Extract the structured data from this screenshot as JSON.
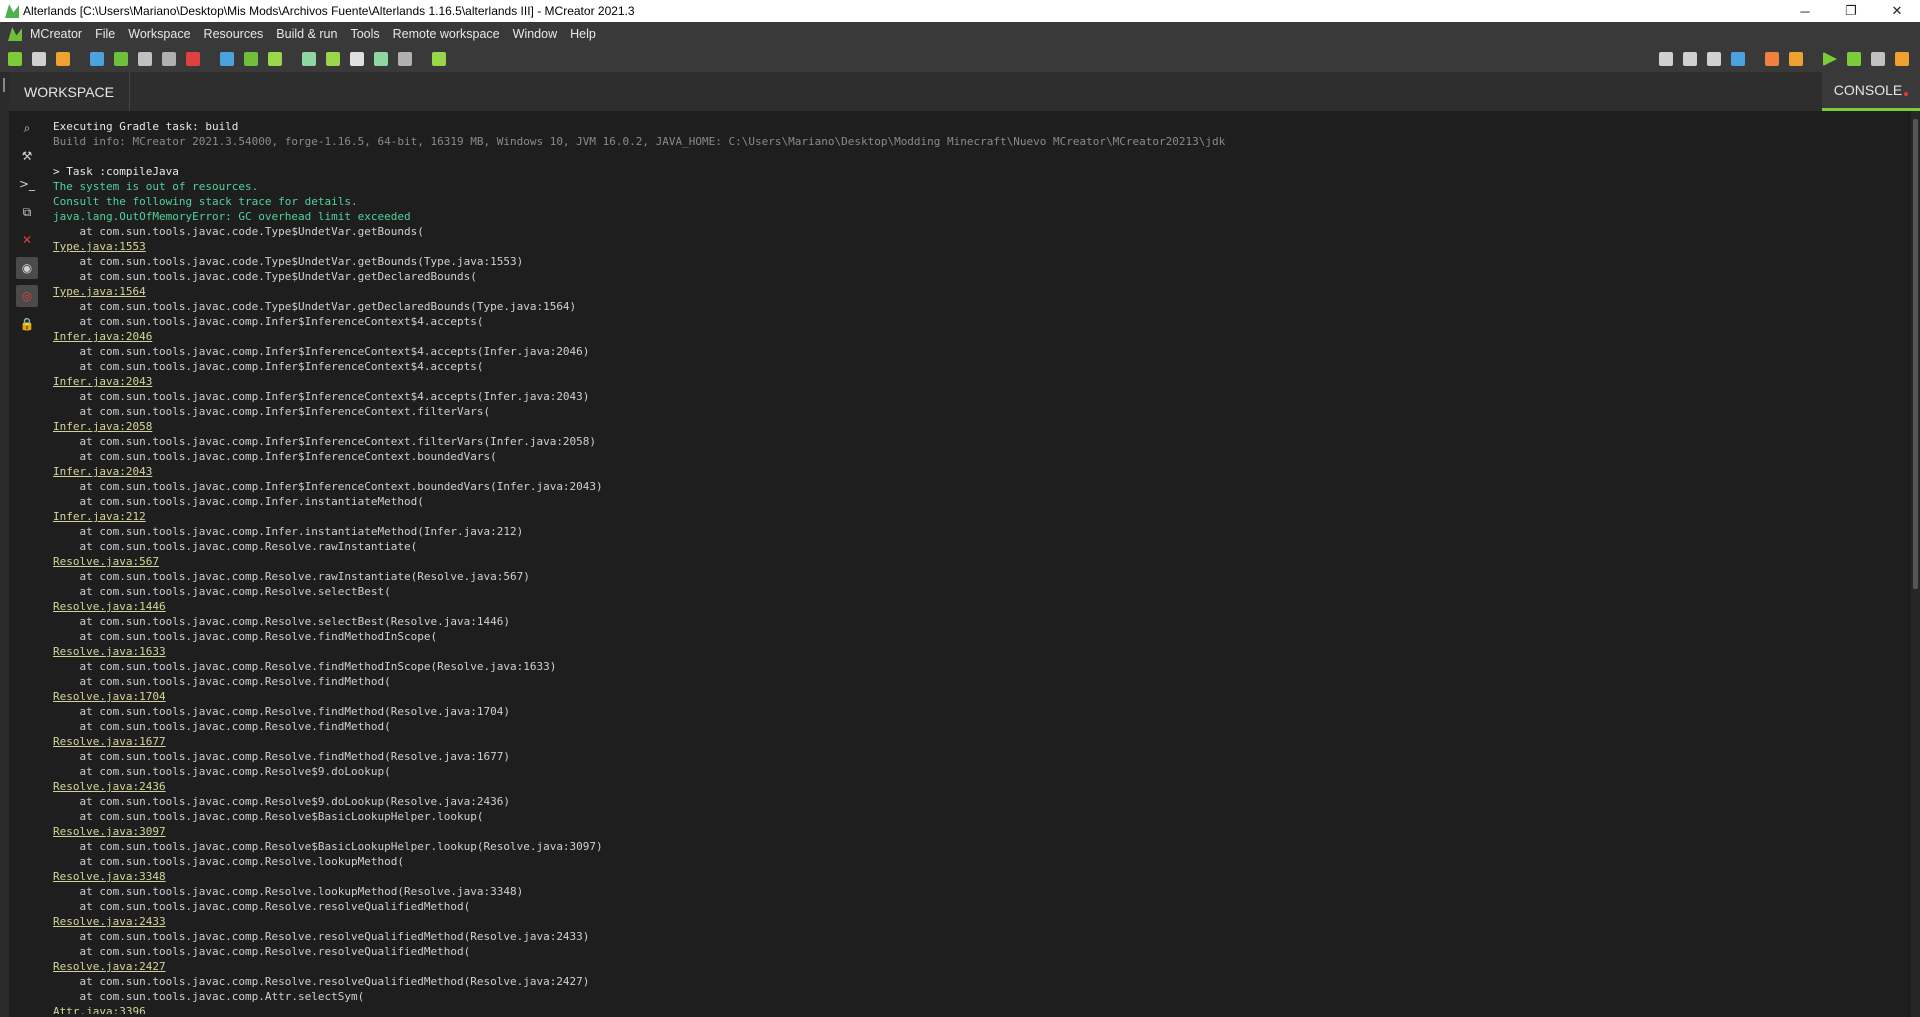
{
  "window": {
    "title": "Alterlands [C:\\Users\\Mariano\\Desktop\\Mis Mods\\Archivos Fuente\\Alterlands 1.16.5\\alterlands III] - MCreator 2021.3",
    "controls": {
      "minimize": "─",
      "restore": "❐",
      "close": "✕"
    }
  },
  "menu": {
    "items": [
      "MCreator",
      "File",
      "Workspace",
      "Resources",
      "Build & run",
      "Tools",
      "Remote workspace",
      "Window",
      "Help"
    ]
  },
  "toolbar": {
    "left_icons": [
      {
        "name": "new-element-icon",
        "color": "#7ccc3a"
      },
      {
        "name": "workspace-icon",
        "color": "#cfcfcf"
      },
      {
        "name": "import-icon",
        "color": "#f0a030"
      },
      {
        "name": "resources-icon",
        "color": "#4aa3df"
      },
      {
        "name": "image-icon",
        "color": "#6fbf3b"
      },
      {
        "name": "structure-icon",
        "color": "#c0c0c0"
      },
      {
        "name": "sound-icon",
        "color": "#b0b0b0"
      },
      {
        "name": "texture-icon",
        "color": "#e04040"
      },
      {
        "name": "armor-icon",
        "color": "#4aa3df"
      },
      {
        "name": "recipe-icon",
        "color": "#6fbf3b"
      },
      {
        "name": "animation-icon",
        "color": "#9ad64a"
      },
      {
        "name": "plugin-icon",
        "color": "#8fd6a0"
      },
      {
        "name": "tools-icon",
        "color": "#9ad64a"
      },
      {
        "name": "gear-icon",
        "color": "#e0e0e0"
      },
      {
        "name": "mod-icon",
        "color": "#8fd6a0"
      },
      {
        "name": "block-icon",
        "color": "#b0b0b0"
      },
      {
        "name": "pencil-icon",
        "color": "#9ad64a"
      }
    ],
    "right_icons": [
      {
        "name": "branch-icon",
        "color": "#d0d0d0"
      },
      {
        "name": "pull-icon",
        "color": "#d0d0d0"
      },
      {
        "name": "push-icon",
        "color": "#d0d0d0"
      },
      {
        "name": "folder-icon",
        "color": "#4aa3df"
      },
      {
        "name": "eraser-icon",
        "color": "#f08040"
      },
      {
        "name": "hammer-icon",
        "color": "#f0a030"
      },
      {
        "name": "play-icon",
        "color": "#7ccc3a"
      },
      {
        "name": "debug-icon",
        "color": "#7ccc3a"
      },
      {
        "name": "stop-icon",
        "color": "#c0c0c0"
      },
      {
        "name": "export-icon",
        "color": "#f0a030"
      }
    ]
  },
  "tabs": {
    "workspace": "WORKSPACE",
    "console": "CONSOLE"
  },
  "sidebar": {
    "buttons": [
      {
        "name": "search-icon",
        "glyph": "⌕",
        "active": false
      },
      {
        "name": "hammer-icon",
        "glyph": "⚒",
        "active": false
      },
      {
        "name": "terminal-icon",
        "glyph": ">_",
        "active": false
      },
      {
        "name": "copy-icon",
        "glyph": "⧉",
        "active": false
      },
      {
        "name": "close-icon",
        "glyph": "✕",
        "active": false,
        "color": "#e04040"
      },
      {
        "name": "eye-icon",
        "glyph": "◉",
        "active": true
      },
      {
        "name": "eye-off-icon",
        "glyph": "◎",
        "active": true,
        "color": "#e04040"
      },
      {
        "name": "lock-icon",
        "glyph": "🔒",
        "active": false
      }
    ]
  },
  "console": {
    "lines": [
      {
        "t": "Executing Gradle task: build",
        "s": "normal"
      },
      {
        "t": "Build info: MCreator 2021.3.54000, forge-1.16.5, 64-bit, 16319 MB, Windows 10, JVM 16.0.2, JAVA_HOME: C:\\Users\\Mariano\\Desktop\\Modding Minecraft\\Nuevo MCreator\\MCreator20213\\jdk",
        "s": "dim"
      },
      {
        "t": "",
        "s": "normal"
      },
      {
        "t": "> Task :compileJava",
        "s": "normal"
      },
      {
        "t": "The system is out of resources.",
        "s": "green"
      },
      {
        "t": "Consult the following stack trace for details.",
        "s": "green"
      },
      {
        "t": "java.lang.OutOfMemoryError: GC overhead limit exceeded",
        "s": "green"
      },
      {
        "t": "    at com.sun.tools.javac.code.Type$UndetVar.getBounds(",
        "s": "at"
      },
      {
        "t": "Type.java:1553",
        "s": "link"
      },
      {
        "t": "    at com.sun.tools.javac.code.Type$UndetVar.getBounds(Type.java:1553)",
        "s": "at"
      },
      {
        "t": "    at com.sun.tools.javac.code.Type$UndetVar.getDeclaredBounds(",
        "s": "at"
      },
      {
        "t": "Type.java:1564",
        "s": "link"
      },
      {
        "t": "    at com.sun.tools.javac.code.Type$UndetVar.getDeclaredBounds(Type.java:1564)",
        "s": "at"
      },
      {
        "t": "    at com.sun.tools.javac.comp.Infer$InferenceContext$4.accepts(",
        "s": "at"
      },
      {
        "t": "Infer.java:2046",
        "s": "link"
      },
      {
        "t": "    at com.sun.tools.javac.comp.Infer$InferenceContext$4.accepts(Infer.java:2046)",
        "s": "at"
      },
      {
        "t": "    at com.sun.tools.javac.comp.Infer$InferenceContext$4.accepts(",
        "s": "at"
      },
      {
        "t": "Infer.java:2043",
        "s": "link"
      },
      {
        "t": "    at com.sun.tools.javac.comp.Infer$InferenceContext$4.accepts(Infer.java:2043)",
        "s": "at"
      },
      {
        "t": "    at com.sun.tools.javac.comp.Infer$InferenceContext.filterVars(",
        "s": "at"
      },
      {
        "t": "Infer.java:2058",
        "s": "link"
      },
      {
        "t": "    at com.sun.tools.javac.comp.Infer$InferenceContext.filterVars(Infer.java:2058)",
        "s": "at"
      },
      {
        "t": "    at com.sun.tools.javac.comp.Infer$InferenceContext.boundedVars(",
        "s": "at"
      },
      {
        "t": "Infer.java:2043",
        "s": "link"
      },
      {
        "t": "    at com.sun.tools.javac.comp.Infer$InferenceContext.boundedVars(Infer.java:2043)",
        "s": "at"
      },
      {
        "t": "    at com.sun.tools.javac.comp.Infer.instantiateMethod(",
        "s": "at"
      },
      {
        "t": "Infer.java:212",
        "s": "link"
      },
      {
        "t": "    at com.sun.tools.javac.comp.Infer.instantiateMethod(Infer.java:212)",
        "s": "at"
      },
      {
        "t": "    at com.sun.tools.javac.comp.Resolve.rawInstantiate(",
        "s": "at"
      },
      {
        "t": "Resolve.java:567",
        "s": "link"
      },
      {
        "t": "    at com.sun.tools.javac.comp.Resolve.rawInstantiate(Resolve.java:567)",
        "s": "at"
      },
      {
        "t": "    at com.sun.tools.javac.comp.Resolve.selectBest(",
        "s": "at"
      },
      {
        "t": "Resolve.java:1446",
        "s": "link"
      },
      {
        "t": "    at com.sun.tools.javac.comp.Resolve.selectBest(Resolve.java:1446)",
        "s": "at"
      },
      {
        "t": "    at com.sun.tools.javac.comp.Resolve.findMethodInScope(",
        "s": "at"
      },
      {
        "t": "Resolve.java:1633",
        "s": "link"
      },
      {
        "t": "    at com.sun.tools.javac.comp.Resolve.findMethodInScope(Resolve.java:1633)",
        "s": "at"
      },
      {
        "t": "    at com.sun.tools.javac.comp.Resolve.findMethod(",
        "s": "at"
      },
      {
        "t": "Resolve.java:1704",
        "s": "link"
      },
      {
        "t": "    at com.sun.tools.javac.comp.Resolve.findMethod(Resolve.java:1704)",
        "s": "at"
      },
      {
        "t": "    at com.sun.tools.javac.comp.Resolve.findMethod(",
        "s": "at"
      },
      {
        "t": "Resolve.java:1677",
        "s": "link"
      },
      {
        "t": "    at com.sun.tools.javac.comp.Resolve.findMethod(Resolve.java:1677)",
        "s": "at"
      },
      {
        "t": "    at com.sun.tools.javac.comp.Resolve$9.doLookup(",
        "s": "at"
      },
      {
        "t": "Resolve.java:2436",
        "s": "link"
      },
      {
        "t": "    at com.sun.tools.javac.comp.Resolve$9.doLookup(Resolve.java:2436)",
        "s": "at"
      },
      {
        "t": "    at com.sun.tools.javac.comp.Resolve$BasicLookupHelper.lookup(",
        "s": "at"
      },
      {
        "t": "Resolve.java:3097",
        "s": "link"
      },
      {
        "t": "    at com.sun.tools.javac.comp.Resolve$BasicLookupHelper.lookup(Resolve.java:3097)",
        "s": "at"
      },
      {
        "t": "    at com.sun.tools.javac.comp.Resolve.lookupMethod(",
        "s": "at"
      },
      {
        "t": "Resolve.java:3348",
        "s": "link"
      },
      {
        "t": "    at com.sun.tools.javac.comp.Resolve.lookupMethod(Resolve.java:3348)",
        "s": "at"
      },
      {
        "t": "    at com.sun.tools.javac.comp.Resolve.resolveQualifiedMethod(",
        "s": "at"
      },
      {
        "t": "Resolve.java:2433",
        "s": "link"
      },
      {
        "t": "    at com.sun.tools.javac.comp.Resolve.resolveQualifiedMethod(Resolve.java:2433)",
        "s": "at"
      },
      {
        "t": "    at com.sun.tools.javac.comp.Resolve.resolveQualifiedMethod(",
        "s": "at"
      },
      {
        "t": "Resolve.java:2427",
        "s": "link"
      },
      {
        "t": "    at com.sun.tools.javac.comp.Resolve.resolveQualifiedMethod(Resolve.java:2427)",
        "s": "at"
      },
      {
        "t": "    at com.sun.tools.javac.comp.Attr.selectSym(",
        "s": "at"
      },
      {
        "t": "Attr.java:3396",
        "s": "link"
      }
    ]
  }
}
